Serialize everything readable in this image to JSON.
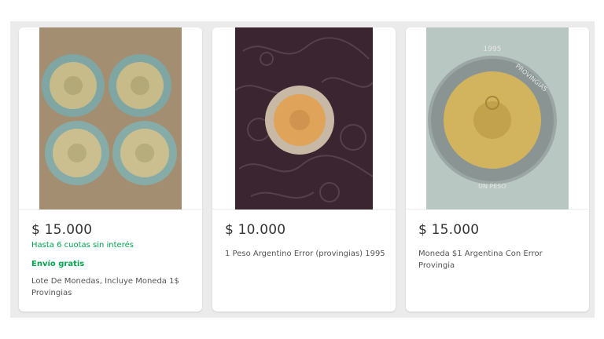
{
  "listings": [
    {
      "price": "$ 15.000",
      "installments": "Hasta 6 cuotas sin interés",
      "shipping": "Envío gratis",
      "title": "Lote De Monedas, Incluye Moneda 1$ Provingias",
      "image": "four-coins-on-cardboard"
    },
    {
      "price": "$ 10.000",
      "title": "1 Peso Argentino Error (provingias) 1995",
      "image": "coin-on-embossed-leather"
    },
    {
      "price": "$ 15.000",
      "title": "Moneda $1 Argentina Con Error Provingia",
      "image": "coin-closeup",
      "coin_text": [
        "1995",
        "PROVINGIAS",
        "UN PESO"
      ]
    }
  ],
  "colors": {
    "background": "#ebebeb",
    "card": "#ffffff",
    "price_text": "#333333",
    "accent_green": "#00a650",
    "title_text": "#555555"
  }
}
